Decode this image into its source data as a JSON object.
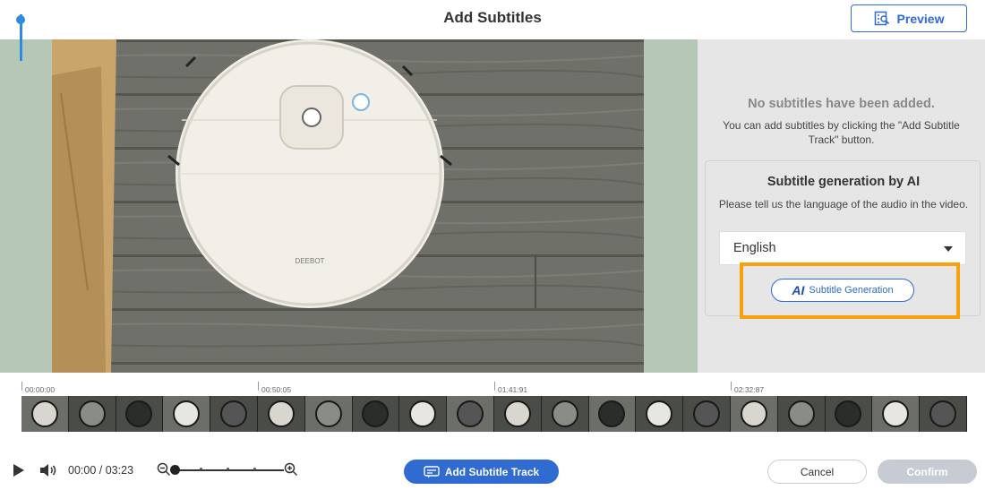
{
  "header": {
    "title": "Add Subtitles",
    "preview_label": "Preview"
  },
  "video": {
    "robot_brand_text": "DEEBOT"
  },
  "right_panel": {
    "empty_title": "No subtitles have been added.",
    "empty_description": "You can add subtitles by clicking the \"Add Subtitle Track\" button.",
    "ai_section": {
      "title": "Subtitle generation by AI",
      "description": "Please tell us the language of the audio in the video.",
      "language_selected": "English",
      "generate_button_badge": "AI",
      "generate_button_label": "Subtitle Generation"
    }
  },
  "timeline": {
    "tick_labels": [
      "00:00:00",
      "00:50:05",
      "01:41:91",
      "02:32:87"
    ],
    "thumbnail_count": 20
  },
  "controls": {
    "current_time": "00:00",
    "separator": "/",
    "duration": "03:23",
    "add_track_label": "Add Subtitle Track",
    "cancel_label": "Cancel",
    "confirm_label": "Confirm"
  },
  "colors": {
    "accent": "#2f6bd1",
    "highlight": "#f5a20d",
    "panel_bg": "#e6e6e6",
    "video_side_bg": "#b5c8b8",
    "confirm_disabled": "#c7ccd4"
  }
}
